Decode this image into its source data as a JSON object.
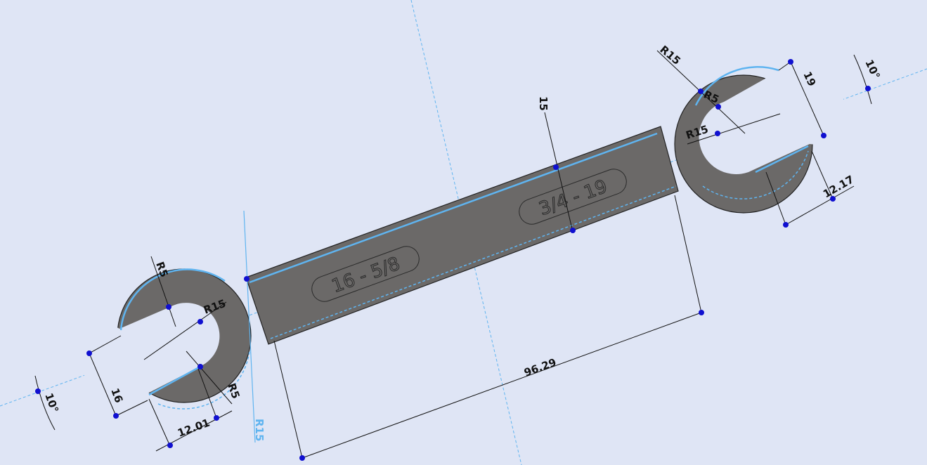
{
  "viewport": {
    "background": "#dfe5f5",
    "part_color": "#6b6968",
    "sketch_color": "#5fb4f0",
    "point_color": "#1010d0"
  },
  "engravings": {
    "left": "16 - 5/8",
    "right": "3/4 - 19"
  },
  "dimensions": {
    "left_r5_top": "R5",
    "left_r15": "R15",
    "left_r5_bottom": "R5",
    "left_width": "16",
    "left_jaw": "12.01",
    "left_angle": "10°",
    "left_neck_r15": "R15",
    "length": "96.29",
    "handle_width": "15",
    "right_r15_top": "R15",
    "right_r5": "R5",
    "right_r15": "R15",
    "right_width": "19",
    "right_jaw": "12.17",
    "right_angle": "10°"
  }
}
